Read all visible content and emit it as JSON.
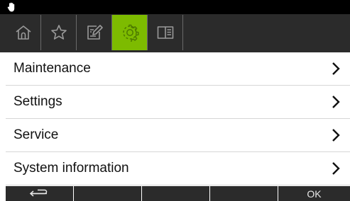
{
  "status": {
    "icon": "hand-icon"
  },
  "tabs": [
    {
      "icon": "home-icon",
      "active": false
    },
    {
      "icon": "star-icon",
      "active": false
    },
    {
      "icon": "edit-icon",
      "active": false
    },
    {
      "icon": "gear-icon",
      "active": true
    },
    {
      "icon": "book-icon",
      "active": false
    }
  ],
  "menu": {
    "items": [
      {
        "label": "Maintenance"
      },
      {
        "label": "Settings"
      },
      {
        "label": "Service"
      },
      {
        "label": "System information"
      }
    ]
  },
  "softkeys": {
    "back_icon": "back-arrow-icon",
    "ok_label": "OK"
  },
  "colors": {
    "accent": "#7dbb00",
    "bar": "#2b2b2b",
    "status": "#000000"
  }
}
